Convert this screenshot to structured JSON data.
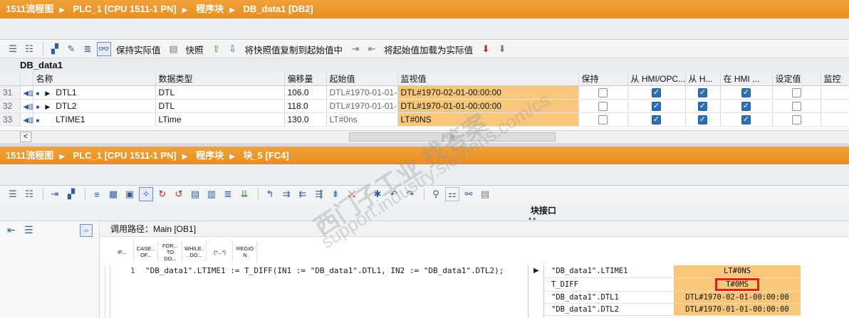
{
  "top_editor": {
    "breadcrumb": [
      "1511流程图",
      "PLC_1 [CPU 1511-1 PN]",
      "程序块",
      "DB_data1 [DB2]"
    ],
    "toolbar": {
      "keep_actual_label": "保持实际值",
      "snapshot_label": "快照",
      "copy_snapshot_label": "将快照值复制到起始值中",
      "load_start_label": "将起始值加载为实际值"
    },
    "db_title": "DB_data1",
    "columns": [
      "名称",
      "数据类型",
      "偏移量",
      "起始值",
      "监视值",
      "保持",
      "从 HMI/OPC...",
      "从 H...",
      "在 HMI ...",
      "设定值",
      "监控"
    ],
    "rows": [
      {
        "num": "31",
        "name": "DTL1",
        "type": "DTL",
        "offset": "106.0",
        "start": "DTL#1970-01-01-",
        "monitor": "DTL#1970-02-01-00:00:00",
        "retain": false,
        "hmi_opc": true,
        "hmi2": true,
        "hmi3": true,
        "setpoint": false,
        "expand": true
      },
      {
        "num": "32",
        "name": "DTL2",
        "type": "DTL",
        "offset": "118.0",
        "start": "DTL#1970-01-01-",
        "monitor": "DTL#1970-01-01-00:00:00",
        "retain": false,
        "hmi_opc": true,
        "hmi2": true,
        "hmi3": true,
        "setpoint": false,
        "expand": true
      },
      {
        "num": "33",
        "name": "LTIME1",
        "type": "LTime",
        "offset": "130.0",
        "start": "LT#0ns",
        "monitor": "LT#0NS",
        "retain": false,
        "hmi_opc": true,
        "hmi2": true,
        "hmi3": true,
        "setpoint": false,
        "expand": false
      }
    ]
  },
  "bottom_editor": {
    "breadcrumb": [
      "1511流程图",
      "PLC_1 [CPU 1511-1 PN]",
      "程序块",
      "块_5 [FC4]"
    ],
    "block_interface_label": "块接口",
    "call_path": "调用路径：Main [OB1]",
    "scl_templates": [
      "IF...",
      "CASE... OF...",
      "FOR... TO DO...",
      "WHILE... DO...",
      "(*...*)",
      "REGION"
    ],
    "code": {
      "line_number": "1",
      "text": "\"DB_data1\".LTIME1 := T_DIFF(IN1 := \"DB_data1\".DTL1, IN2 := \"DB_data1\".DTL2);"
    },
    "watch_table": [
      {
        "name": "\"DB_data1\".LTIME1",
        "value": "LT#0NS",
        "highlight": false
      },
      {
        "name": "T_DIFF",
        "value": "T#0MS",
        "highlight": true
      },
      {
        "name": "\"DB_data1\".DTL1",
        "value": "DTL#1970-02-01-00:00:00",
        "highlight": false
      },
      {
        "name": "\"DB_data1\".DTL2",
        "value": "DTL#1970-01-01-00:00:00",
        "highlight": false
      }
    ]
  },
  "watermark": {
    "line1": "西门子工业 找答案",
    "line2": "support.industry.siemens.com/cs"
  },
  "colors": {
    "title_orange": "#ec9527",
    "monitor_orange": "#f8c779",
    "highlight_red": "#e0201c",
    "checkbox_blue": "#2b6fb6"
  }
}
